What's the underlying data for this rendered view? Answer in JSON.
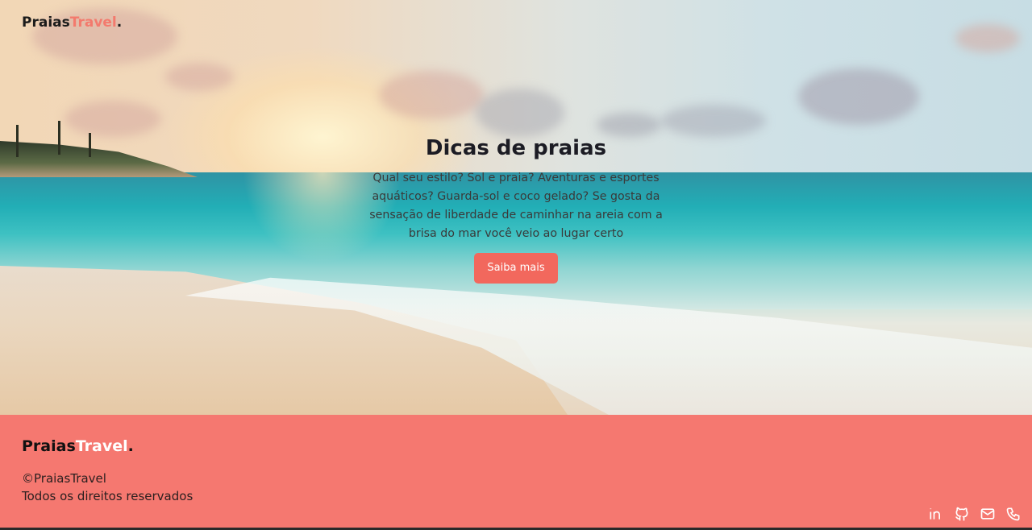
{
  "brand": {
    "name": "Praias",
    "accent": "Travel",
    "dot": ".",
    "coral": "#f37a6d"
  },
  "hero": {
    "title": "Dicas de praias",
    "text": "Qual seu estilo? Sol e praia? Aventuras e esportes aquáticos? Guarda-sol e coco gelado? Se gosta da sensação de liberdade de caminhar na areia com a brisa do mar você veio ao lugar certo",
    "cta_label": "Saiba mais"
  },
  "footer": {
    "brand_name": "Praias",
    "brand_accent": "Travel",
    "brand_dot": ".",
    "copyright": "©PraiasTravel",
    "rights": "Todos os direitos reservados",
    "background": "#f57870",
    "social_icons": [
      "linkedin-icon",
      "github-icon",
      "mail-icon",
      "phone-icon"
    ]
  }
}
